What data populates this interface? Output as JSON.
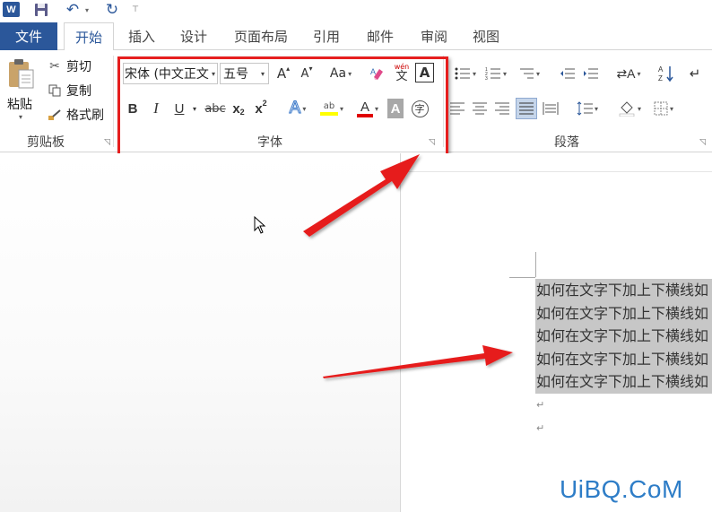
{
  "qat": {
    "logo_text": "W",
    "save": "save",
    "undo": "↶",
    "redo": "↻"
  },
  "tabs": {
    "file": "文件",
    "items": [
      "开始",
      "插入",
      "设计",
      "页面布局",
      "引用",
      "邮件",
      "审阅",
      "视图"
    ],
    "active": "开始"
  },
  "clipboard": {
    "paste": "粘贴",
    "cut": "剪切",
    "copy": "复制",
    "format_painter": "格式刷",
    "group_label": "剪贴板"
  },
  "font": {
    "font_name": "宋体 (中文正文",
    "font_size": "五号",
    "grow": "A",
    "shrink": "A",
    "change_case": "Aa",
    "phonetic_top": "wén",
    "phonetic_bottom": "文",
    "char_border": "A",
    "bold": "B",
    "italic": "I",
    "underline": "U",
    "strikethrough": "abc",
    "subscript": "x",
    "subscript_mark": "2",
    "superscript": "x",
    "superscript_mark": "2",
    "text_effects": "A",
    "highlight": "ab",
    "font_color": "A",
    "char_shading": "A",
    "enclose": "字",
    "group_label": "字体"
  },
  "paragraph": {
    "group_label": "段落"
  },
  "document": {
    "lines": [
      "如何在文字下加上下横线如",
      "如何在文字下加上下横线如",
      "如何在文字下加上下横线如",
      "如何在文字下加上下横线如",
      "如何在文字下加上下横线如"
    ],
    "para_mark": "↵"
  },
  "watermark": "UiBQ.CoM",
  "colors": {
    "brand": "#2b579a",
    "highlight_box": "#e61e1e",
    "selection": "#c7c7c7",
    "watermark": "#2e7dc7"
  }
}
